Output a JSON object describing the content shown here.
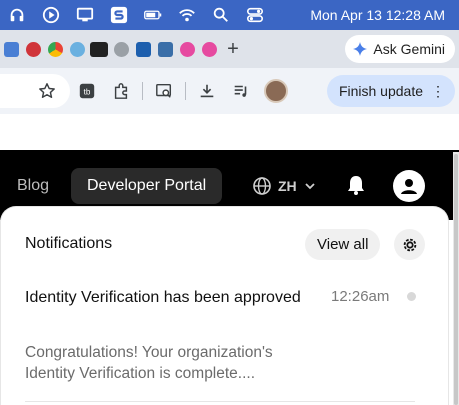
{
  "menubar": {
    "datetime": "Mon Apr 13  12:28 AM",
    "icons": [
      "headphones-icon",
      "play-circle-icon",
      "display-icon",
      "s-app-icon",
      "battery-icon",
      "wifi-icon",
      "search-icon",
      "control-center-icon"
    ]
  },
  "tabstrip": {
    "new_tab": "+",
    "gemini_label": "Ask Gemini"
  },
  "toolbar": {
    "finish_update_label": "Finish update",
    "more_icon": "⋮"
  },
  "sitenav": {
    "blog": "Blog",
    "developer_portal": "Developer Portal",
    "language": "ZH"
  },
  "notifications": {
    "title": "Notifications",
    "view_all": "View all",
    "items": [
      {
        "title": "Identity Verification has been approved",
        "time": "12:26am",
        "body": "Congratulations! Your organization's Identity Verification is complete...."
      }
    ]
  },
  "colors": {
    "menubar": "#3b66c4",
    "nav_background": "#000000",
    "finish_update_bg": "#d3e3fd"
  }
}
